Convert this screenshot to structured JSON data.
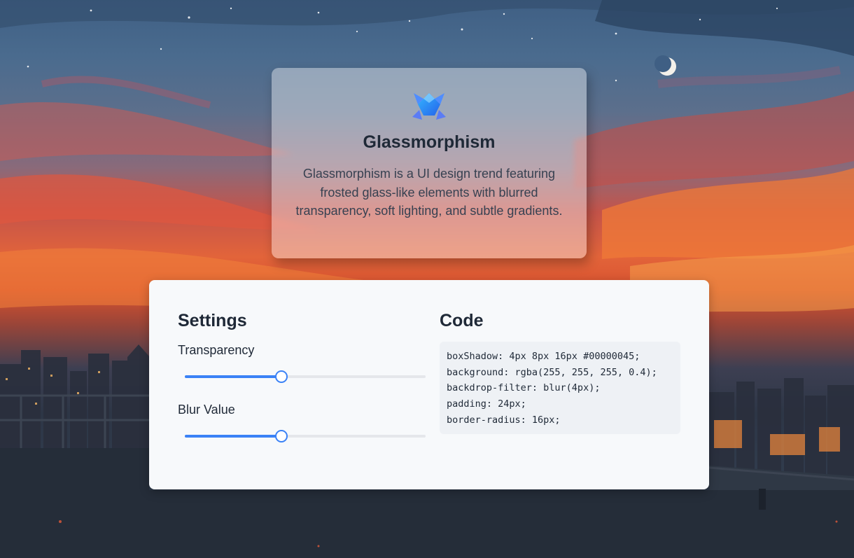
{
  "card": {
    "title": "Glassmorphism",
    "description": "Glassmorphism is a UI design trend featuring frosted glass-like elements with blurred transparency, soft lighting, and subtle gradients.",
    "logo_icon": "crystal-logo-icon"
  },
  "settings": {
    "title": "Settings",
    "transparency": {
      "label": "Transparency",
      "value": 0.4
    },
    "blur": {
      "label": "Blur Value",
      "value": 0.4
    }
  },
  "code": {
    "title": "Code",
    "lines": [
      "boxShadow: 4px 8px 16px #00000045;",
      "background: rgba(255, 255, 255, 0.4);",
      "backdrop-filter: blur(4px);",
      "padding: 24px;",
      "border-radius: 16px;"
    ]
  },
  "colors": {
    "accent": "#3b82f6",
    "panel_background": "#f7f9fb",
    "code_background": "#eef1f5"
  }
}
